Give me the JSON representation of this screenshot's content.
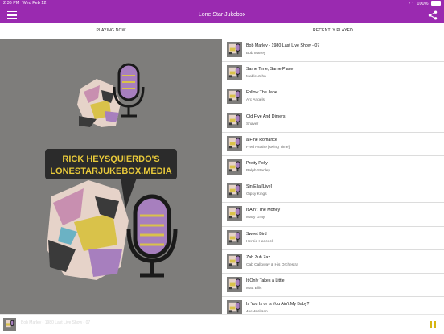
{
  "status_bar": {
    "time": "2:36 PM",
    "date": "Wed Feb 12",
    "battery": "100%"
  },
  "app": {
    "title": "Lone Star Jukebox"
  },
  "tabs": [
    {
      "label": "PLAYING NOW",
      "active": true
    },
    {
      "label": "RECENTLY PLAYED",
      "active": false
    }
  ],
  "artwork": {
    "text_line1": "RICK HEYSQUIERDO'S",
    "text_line2": "LONESTARJUKEBOX.MEDIA"
  },
  "recently_played": [
    {
      "title": "Bob Marley - 1980 Last Live Show - 07",
      "artist": "Bob Marley"
    },
    {
      "title": "Same Time, Same Place",
      "artist": "Mable John"
    },
    {
      "title": "Follow The Jane",
      "artist": "Arc Angels"
    },
    {
      "title": "Old Five And Dimers",
      "artist": "Shaver"
    },
    {
      "title": "a Fine Romance",
      "artist": "Fred Astaire [swing Time]"
    },
    {
      "title": "Pretty Polly",
      "artist": "Ralph Stanley"
    },
    {
      "title": "Sin Ella [Live]",
      "artist": "Gipsy Kings"
    },
    {
      "title": "It Ain't The Money",
      "artist": "Macy Gray"
    },
    {
      "title": "Sweet Bird",
      "artist": "Herbie Hancock"
    },
    {
      "title": "Zah Zuh Zaz",
      "artist": "Cab Calloway & His Orchestra"
    },
    {
      "title": "It Only Takes a Little",
      "artist": "Matt Ellis"
    },
    {
      "title": "Is You Is or Is You Ain't My Baby?",
      "artist": "Joe Jackson"
    }
  ],
  "mini_player": {
    "track": "Bob Marley - 1980 Last Live Show - 07"
  },
  "colors": {
    "accent": "#9a2ab0",
    "art_background": "#7e7d7b",
    "banner": "#2b2b2b",
    "banner_text": "#e8c93a",
    "mic_purple": "#a77fbe",
    "pause": "#d6b512"
  }
}
